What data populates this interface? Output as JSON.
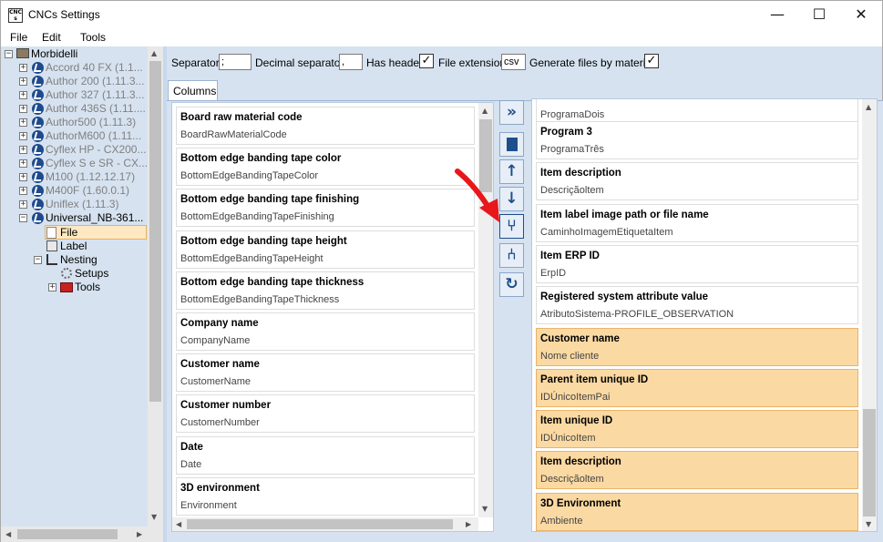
{
  "window": {
    "title": "CNCs Settings",
    "icon_text": "CNC\ns",
    "min": "—",
    "max": "☐",
    "close": "✕"
  },
  "menu": [
    "File",
    "Edit",
    "Tools"
  ],
  "tree": {
    "root": "Morbidelli",
    "machines": [
      "Accord 40 FX (1.1...",
      "Author 200 (1.11.3...",
      "Author 327 (1.11.3...",
      "Author 436S (1.11....",
      "Author500 (1.11.3)",
      "AuthorM600 (1.11...",
      "Cyflex HP - CX200...",
      "Cyflex S e SR - CX...",
      "M100 (1.12.12.17)",
      "M400F (1.60.0.1)",
      "Uniflex (1.11.3)",
      "Universal_NB-361..."
    ],
    "children": [
      "File",
      "Label",
      "Nesting",
      "Setups",
      "Tools"
    ]
  },
  "options": {
    "separator_label": "Separator",
    "separator_value": ";",
    "decimal_label": "Decimal separator",
    "decimal_value": ",",
    "has_header_label": "Has header",
    "has_header_checked": "✓",
    "file_ext_label": "File extension",
    "file_ext_value": "csv",
    "gen_files_label": "Generate files by material",
    "gen_files_checked": "✓"
  },
  "tab": "Columns",
  "available_columns": [
    {
      "title": "Board raw material code",
      "key": "BoardRawMaterialCode"
    },
    {
      "title": "Bottom edge banding tape color",
      "key": "BottomEdgeBandingTapeColor"
    },
    {
      "title": "Bottom edge banding tape finishing",
      "key": "BottomEdgeBandingTapeFinishing"
    },
    {
      "title": "Bottom edge banding tape height",
      "key": "BottomEdgeBandingTapeHeight"
    },
    {
      "title": "Bottom edge banding tape thickness",
      "key": "BottomEdgeBandingTapeThickness"
    },
    {
      "title": "Company name",
      "key": "CompanyName"
    },
    {
      "title": "Customer name",
      "key": "CustomerName"
    },
    {
      "title": "Customer number",
      "key": "CustomerNumber"
    },
    {
      "title": "Date",
      "key": "Date"
    },
    {
      "title": "3D environment",
      "key": "Environment"
    }
  ],
  "selected_columns_partial": "ProgramaDois",
  "selected_columns": [
    {
      "title": "Program 3",
      "key": "ProgramaTrês",
      "highlight": false
    },
    {
      "title": "Item description",
      "key": "Descriçãoltem",
      "highlight": false
    },
    {
      "title": "Item label image path or file name",
      "key": "CaminhoImagemEtiquetaItem",
      "highlight": false
    },
    {
      "title": "Item ERP ID",
      "key": "ErpID",
      "highlight": false
    },
    {
      "title": "Registered system attribute value",
      "key": "AtributoSistema-PROFILE_OBSERVATION",
      "highlight": false
    },
    {
      "title": "Customer name",
      "key": "Nome cliente",
      "highlight": true
    },
    {
      "title": "Parent item unique ID",
      "key": "IDÚnicoItemPai",
      "highlight": true
    },
    {
      "title": "Item unique ID",
      "key": "IDÚnicoItem",
      "highlight": true
    },
    {
      "title": "Item description",
      "key": "Descriçãoltem",
      "highlight": true
    },
    {
      "title": "3D Environment",
      "key": "Ambiente",
      "highlight": true
    }
  ],
  "buttons": {
    "add_all": "»",
    "delete": "🗑",
    "move_up": "↑",
    "move_down": "↓",
    "merge": "⑂",
    "split": "⑃",
    "reset": "↻"
  },
  "colors": {
    "panel_bg": "#d6e2f0",
    "highlight": "#fbd9a2",
    "accent": "#1d4f8c",
    "annotation_arrow": "#e8171b"
  }
}
